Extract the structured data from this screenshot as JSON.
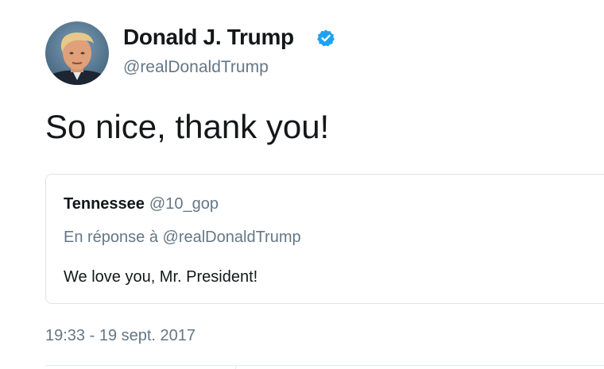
{
  "author": {
    "name": "Donald J. Trump",
    "handle": "@realDonaldTrump",
    "verified": true,
    "avatar_icon": "profile-photo"
  },
  "tweet": {
    "text": "So nice, thank you!",
    "timestamp": "19:33 - 19 sept. 2017"
  },
  "quoted_tweet": {
    "name": "Tennessee",
    "handle": "@10_gop",
    "reply_to": "En réponse à @realDonaldTrump",
    "text": "We love you, Mr. President!"
  },
  "colors": {
    "verified_badge": "#1da1f2",
    "secondary_text": "#657786",
    "primary_text": "#14171a",
    "border": "#dfe3e8"
  }
}
